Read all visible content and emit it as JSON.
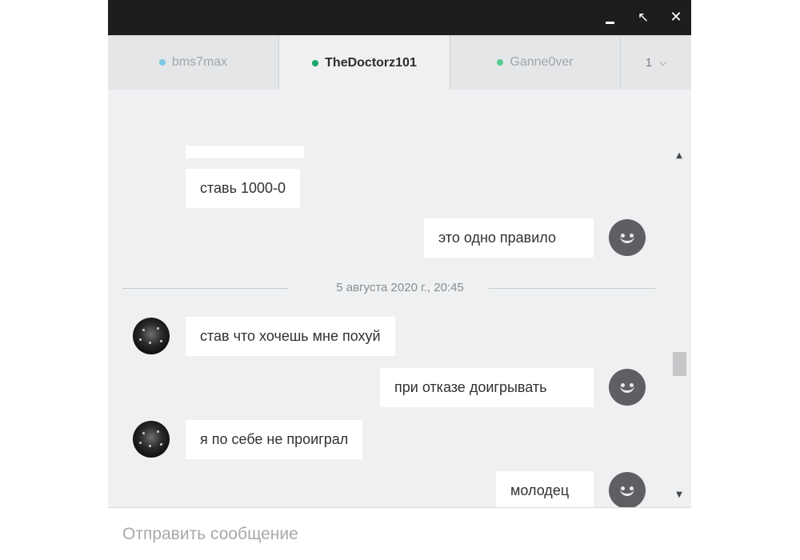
{
  "window": {
    "controls": {
      "restore_icon": "↖",
      "close_icon": "✕"
    }
  },
  "tabs": [
    {
      "label": "bms7max",
      "dot_color": "#7ec8e3"
    },
    {
      "label": "TheDoctorz101",
      "dot_color": "#1aa865"
    },
    {
      "label": "Ganne0ver",
      "dot_color": "#58c98f"
    },
    {
      "label": "1",
      "icon": "chevron-down-icon"
    }
  ],
  "messages": [
    {
      "from": "other",
      "text": "ставь 1000-0"
    },
    {
      "from": "self",
      "text": "это одно правило"
    },
    {
      "from": "other",
      "text": "став что хочешь мне похуй"
    },
    {
      "from": "self",
      "text": "при отказе доигрывать"
    },
    {
      "from": "other",
      "text": "я по себе не проиграл"
    },
    {
      "from": "self",
      "text": "молодец"
    }
  ],
  "date_separator": "5 августа 2020 г., 20:45",
  "composer": {
    "placeholder": "Отправить сообщение"
  },
  "colors": {
    "titlebar": "#1b1d1f",
    "chat_bg": "#eef0f1",
    "bubble": "#ffffff"
  }
}
